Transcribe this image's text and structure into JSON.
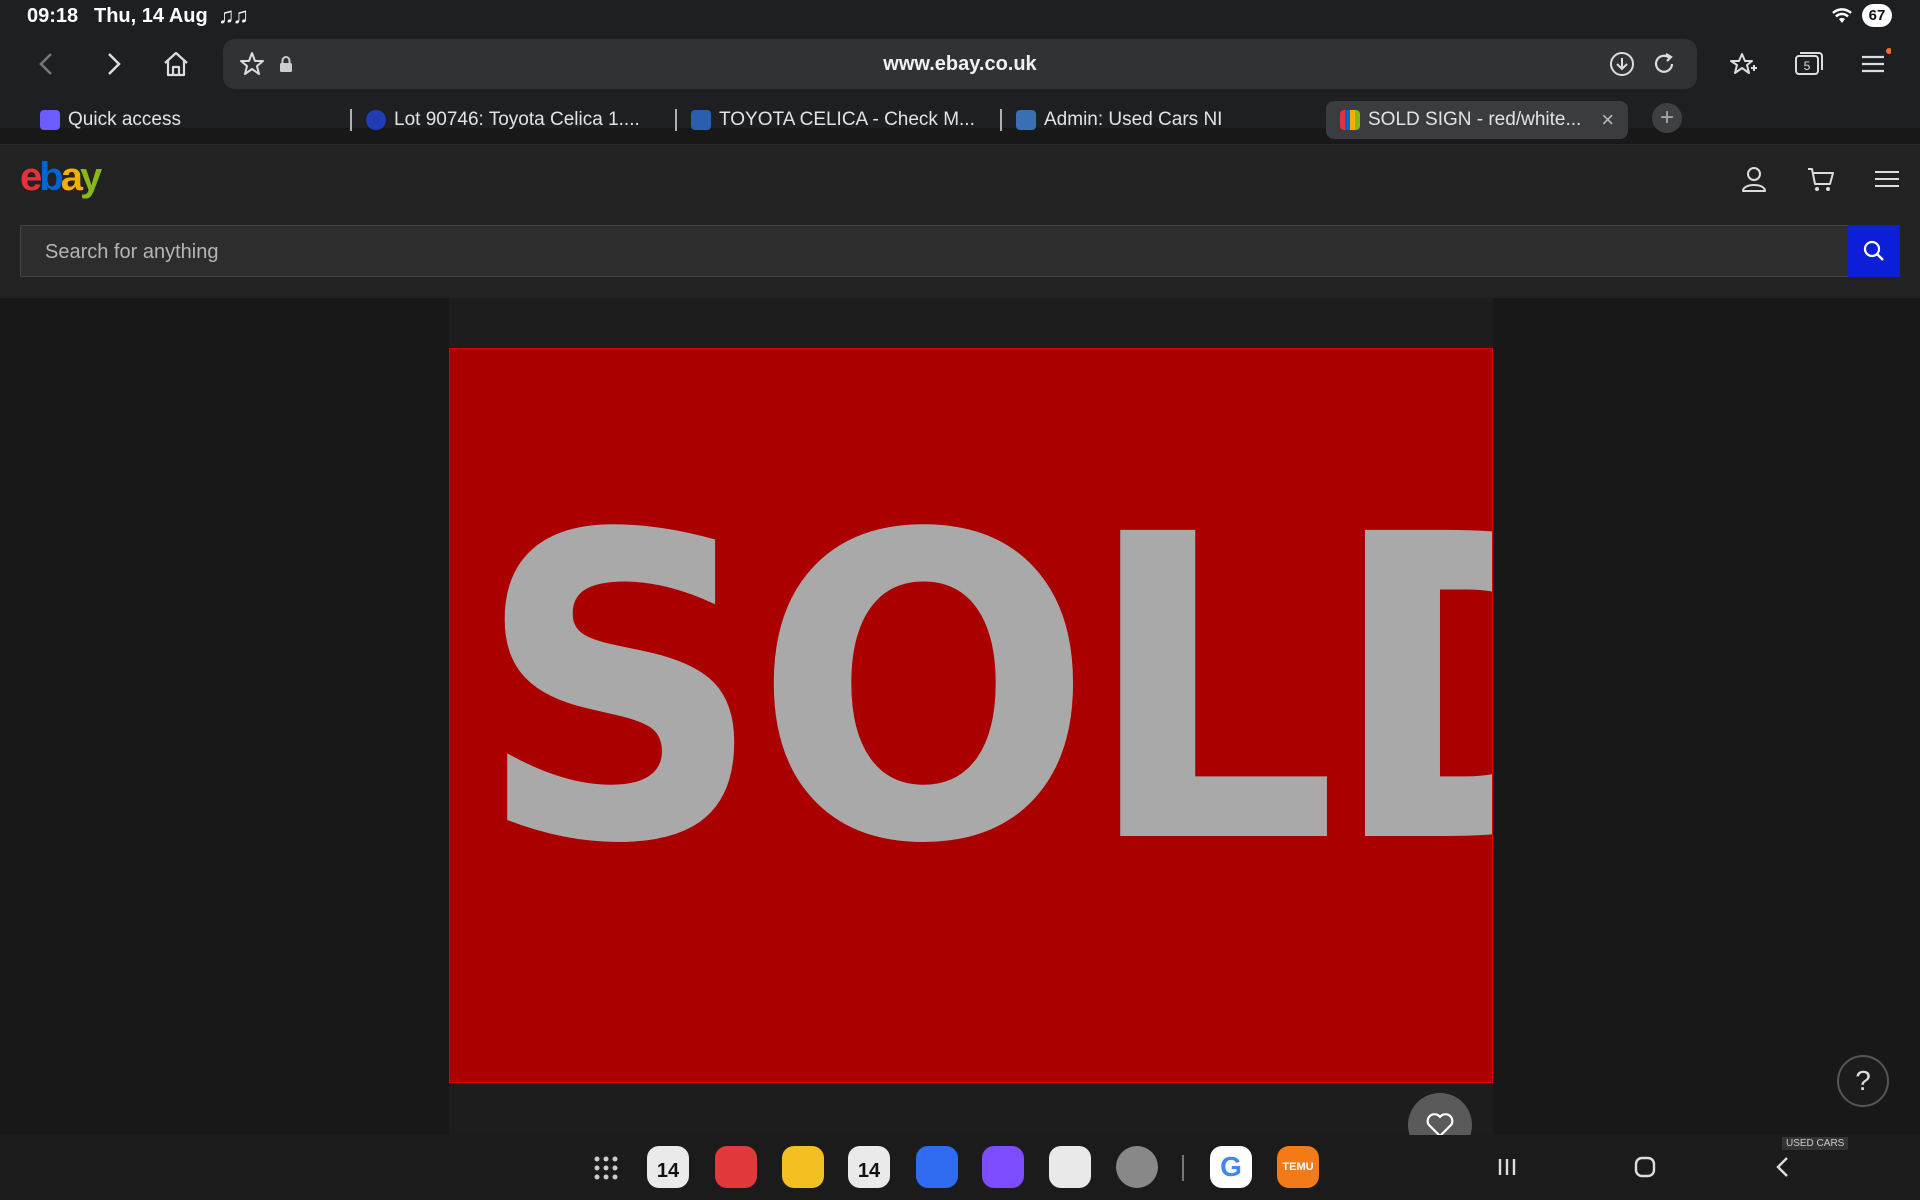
{
  "status": {
    "time": "09:18",
    "date": "Thu, 14 Aug",
    "notification_glyphs": "♫♫",
    "battery": "67"
  },
  "browser": {
    "url": "www.ebay.co.uk",
    "tab_count": "5",
    "tabs": [
      {
        "label": "Quick access",
        "color": "#6a5cff"
      },
      {
        "label": "Lot 90746: Toyota Celica 1....",
        "color": "#1f3cb5"
      },
      {
        "label": "TOYOTA CELICA - Check M...",
        "color": "#2a5fb0"
      },
      {
        "label": "Admin: Used Cars NI",
        "color": "#3a6fb5"
      },
      {
        "label": "SOLD SIGN - red/white...",
        "color": "#e05a2a"
      }
    ]
  },
  "ebay": {
    "logo": {
      "e": "e",
      "b": "b",
      "a": "a",
      "y": "y"
    },
    "search_placeholder": "Search for anything"
  },
  "listing": {
    "sign_text": "SOLD",
    "sign_color": "#ab0000",
    "text_color": "#a9a9a9"
  },
  "help_label": "?",
  "dock": {
    "apps": [
      {
        "name": "calendar",
        "color": "#eaeaea",
        "label": "14"
      },
      {
        "name": "notes",
        "color": "#e23a3a",
        "label": ""
      },
      {
        "name": "files",
        "color": "#f2c021",
        "label": ""
      },
      {
        "name": "calendar-2",
        "color": "#eaeaea",
        "label": "14"
      },
      {
        "name": "messages",
        "color": "#2e6bf0",
        "label": ""
      },
      {
        "name": "browser",
        "color": "#7b4dff",
        "label": ""
      },
      {
        "name": "camera",
        "color": "#e9e9e9",
        "label": ""
      },
      {
        "name": "settings",
        "color": "#888888",
        "label": ""
      },
      {
        "name": "google",
        "color": "#ffffff",
        "label": "G"
      },
      {
        "name": "temu",
        "color": "#f27a18",
        "label": "TEMU"
      }
    ],
    "badge": "USED CARS"
  }
}
